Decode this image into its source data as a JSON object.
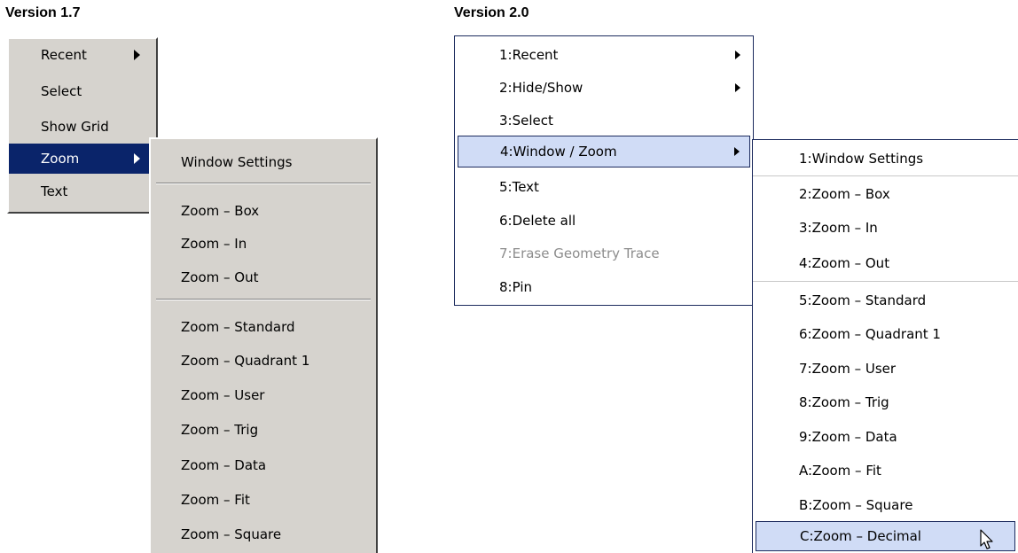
{
  "labels": {
    "v17": "Version 1.7",
    "v20": "Version 2.0"
  },
  "v17": {
    "main": [
      "Recent",
      "Select",
      "Show Grid",
      "Zoom",
      "Text"
    ],
    "sub": [
      "Window Settings",
      "Zoom – Box",
      "Zoom – In",
      "Zoom – Out",
      "Zoom – Standard",
      "Zoom – Quadrant 1",
      "Zoom – User",
      "Zoom – Trig",
      "Zoom – Data",
      "Zoom – Fit",
      "Zoom – Square"
    ]
  },
  "v20": {
    "main": [
      "1:Recent",
      "2:Hide/Show",
      "3:Select",
      "4:Window / Zoom",
      "5:Text",
      "6:Delete all",
      "7:Erase Geometry Trace",
      "8:Pin"
    ],
    "sub": [
      "1:Window Settings",
      "2:Zoom – Box",
      "3:Zoom – In",
      "4:Zoom – Out",
      "5:Zoom – Standard",
      "6:Zoom – Quadrant 1",
      "7:Zoom – User",
      "8:Zoom – Trig",
      "9:Zoom – Data",
      "A:Zoom – Fit",
      "B:Zoom – Square",
      "C:Zoom – Decimal"
    ]
  },
  "colors": {
    "old_menu_bg": "#d6d3ce",
    "old_selection": "#0a246a",
    "new_highlight": "#d0dcf6",
    "new_border": "#1c2b5e",
    "disabled_text": "#8c8c8c"
  }
}
